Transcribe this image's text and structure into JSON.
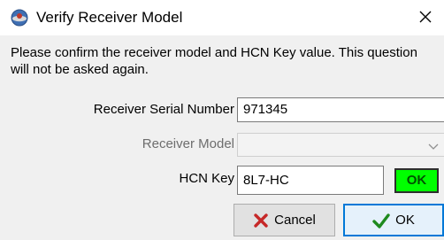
{
  "window": {
    "title": "Verify Receiver Model",
    "icon": "app-icon",
    "close_icon": "close-icon"
  },
  "message": "Please confirm the receiver model and HCN Key value. This question will not be asked again.",
  "fields": {
    "serial_label": "Receiver Serial Number",
    "serial_value": "971345",
    "model_label": "Receiver Model",
    "model_value": "",
    "hcn_label": "HCN Key",
    "hcn_value": "8L7-HC",
    "hcn_status": "OK"
  },
  "buttons": {
    "cancel_label": "Cancel",
    "cancel_icon": "red-x-icon",
    "ok_label": "OK",
    "ok_icon": "green-check-icon"
  },
  "colors": {
    "status_ok": "#00ff00",
    "ok_button_border": "#0078d7",
    "cancel_icon": "#c62828",
    "ok_icon": "#1e8a1e"
  }
}
